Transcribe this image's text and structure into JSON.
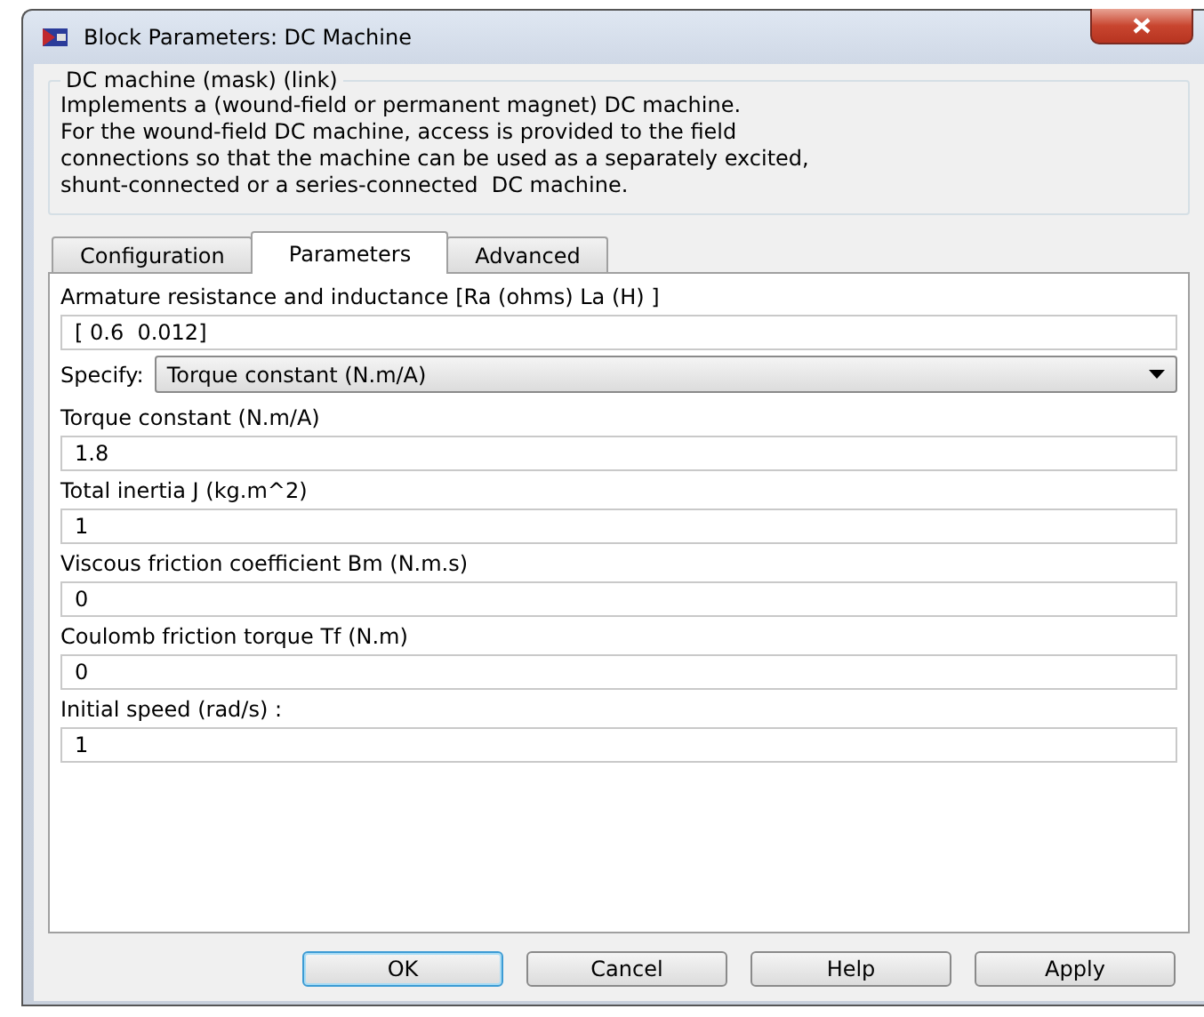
{
  "window": {
    "title": "Block Parameters: DC Machine"
  },
  "description": {
    "title": "DC machine (mask) (link)",
    "text": "Implements a (wound-field or permanent magnet) DC machine.\nFor the wound-field DC machine, access is provided to the field\nconnections so that the machine can be used as a separately excited,\nshunt-connected or a series-connected  DC machine."
  },
  "tabs": [
    {
      "label": "Configuration",
      "selected": false
    },
    {
      "label": "Parameters",
      "selected": true
    },
    {
      "label": "Advanced",
      "selected": false
    }
  ],
  "parameters": [
    {
      "kind": "text",
      "label": "Armature resistance and inductance [Ra (ohms) La (H) ]",
      "value": "[ 0.6  0.012]"
    },
    {
      "kind": "dropdown",
      "label": "Specify:",
      "value": "Torque constant (N.m/A)"
    },
    {
      "kind": "text",
      "label": "Torque constant (N.m/A)",
      "value": "1.8"
    },
    {
      "kind": "text",
      "label": "Total inertia J (kg.m^2)",
      "value": "1"
    },
    {
      "kind": "text",
      "label": "Viscous friction coefficient Bm (N.m.s)",
      "value": "0"
    },
    {
      "kind": "text",
      "label": "Coulomb friction torque Tf (N.m)",
      "value": "0"
    },
    {
      "kind": "text",
      "label": "Initial speed (rad/s) :",
      "value": "1"
    }
  ],
  "buttons": [
    {
      "label": "OK",
      "default": true
    },
    {
      "label": "Cancel",
      "default": false
    },
    {
      "label": "Help",
      "default": false
    },
    {
      "label": "Apply",
      "default": false
    }
  ]
}
